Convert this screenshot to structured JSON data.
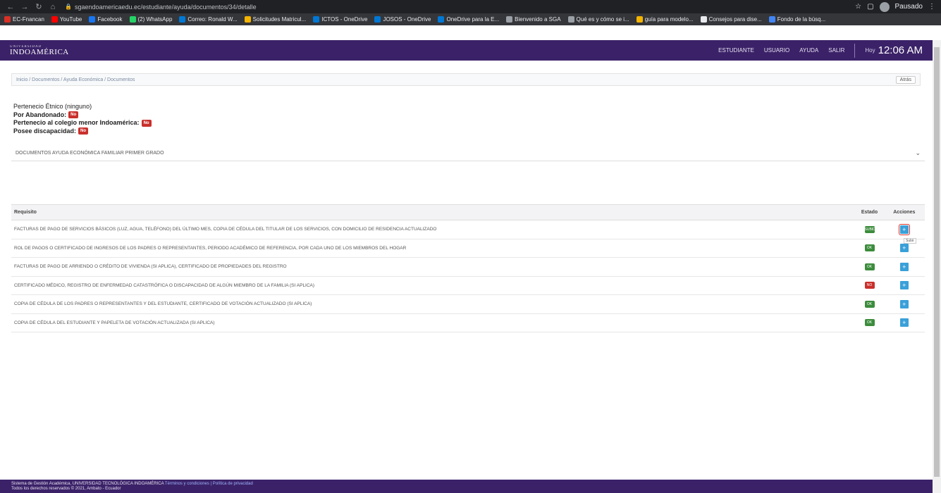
{
  "browser": {
    "url": "sgaendoamericaedu.ec/estudiante/ayuda/documentos/34/detalle",
    "profile_label": "Pausado",
    "bookmarks": [
      {
        "label": "EC-Fnancan",
        "color": "#d93025"
      },
      {
        "label": "YouTube",
        "color": "#ff0000"
      },
      {
        "label": "Facebook",
        "color": "#1877f2"
      },
      {
        "label": "(2) WhatsApp",
        "color": "#25d366"
      },
      {
        "label": "Correo: Ronald W...",
        "color": "#0078d4"
      },
      {
        "label": "Solicitudes Matricul...",
        "color": "#f4b400"
      },
      {
        "label": "ICTOS - OneDrive",
        "color": "#0078d4"
      },
      {
        "label": "JOSOS - OneDrive",
        "color": "#0078d4"
      },
      {
        "label": "OneDrive para la E...",
        "color": "#0078d4"
      },
      {
        "label": "Bienvenido a SGA",
        "color": "#9aa0a6"
      },
      {
        "label": "Qué es y cómo se i...",
        "color": "#9aa0a6"
      },
      {
        "label": "guía para modelo...",
        "color": "#f4b400"
      },
      {
        "label": "Consejos para dise...",
        "color": "#e8eaed"
      },
      {
        "label": "Fondo de la búsq...",
        "color": "#4285f4"
      }
    ]
  },
  "header": {
    "logo_small": "UNIVERSIDAD",
    "logo": "INDOAMÉRICA",
    "links": [
      "ESTUDIANTE",
      "USUARIO",
      "AYUDA",
      "SALIR"
    ],
    "time": "12:06 AM",
    "time_prefix": "Hoy"
  },
  "breadcrumb": {
    "text": "Inicio / Documentos / Ayuda Económica / Documentos",
    "back": "Atrás"
  },
  "profile": {
    "line1": "Pertenecio Étnico (ninguno)",
    "orphan_label": "Por Abandonado:",
    "orphan_value": "No",
    "school_label": "Pertenecio al colegio menor Indoamérica:",
    "school_value": "No",
    "disability_label": "Posee discapacidad:",
    "disability_value": "No"
  },
  "select": {
    "value": "DOCUMENTOS AYUDA ECONÓMICA FAMILIAR PRIMER GRADO"
  },
  "table": {
    "headers": [
      "Requisito",
      "Estado",
      "Acciones"
    ],
    "rows": [
      {
        "name": "FACTURAS DE PAGO DE SERVICIOS BÁSICOS (LUZ, AGUA, TELÉFONO) DEL ÚLTIMO MES, COPIA DE CÉDULA DEL TITULAR DE LOS SERVICIOS, CON DOMICILIO DE RESIDENCIA ACTUALIZADO",
        "state": "SUBIDO",
        "color": "#3c8c3c"
      },
      {
        "name": "ROL DE PAGOS O CERTIFICADO DE INGRESOS DE LOS PADRES O REPRESENTANTES, PERIODO ACADÉMICO DE REFERENCIA, POR CADA UNO DE LOS MIEMBROS DEL HOGAR",
        "state": "OK",
        "color": "#3c8c3c"
      },
      {
        "name": "FACTURAS DE PAGO DE ARRIENDO O CRÉDITO DE VIVIENDA (SI APLICA), CERTIFICADO DE PROPIEDADES DEL REGISTRO",
        "state": "OK",
        "color": "#3c8c3c"
      },
      {
        "name": "CERTIFICADO MÉDICO, REGISTRO DE ENFERMEDAD CATASTRÓFICA O DISCAPACIDAD DE ALGÚN MIEMBRO DE LA FAMILIA (SI APLICA)",
        "state": "NO",
        "color": "#c9302c"
      },
      {
        "name": "COPIA DE CÉDULA DE LOS PADRES O REPRESENTANTES Y DEL ESTUDIANTE, CERTIFICADO DE VOTACIÓN ACTUALIZADO (SI APLICA)",
        "state": "OK",
        "color": "#3c8c3c"
      },
      {
        "name": "COPIA DE CÉDULA DEL ESTUDIANTE Y PAPELETA DE VOTACIÓN ACTUALIZADA (SI APLICA)",
        "state": "OK",
        "color": "#3c8c3c"
      }
    ],
    "upload_tip": "Subir"
  },
  "footer": {
    "line1": "Sistema de Gestión Académica, UNIVERSIDAD TECNOLÓGICA INDOAMÉRICA",
    "link": "Términos y condiciones | Política de privacidad",
    "line2": "Todos los derechos reservados © 2021, Ambato - Ecuador"
  }
}
